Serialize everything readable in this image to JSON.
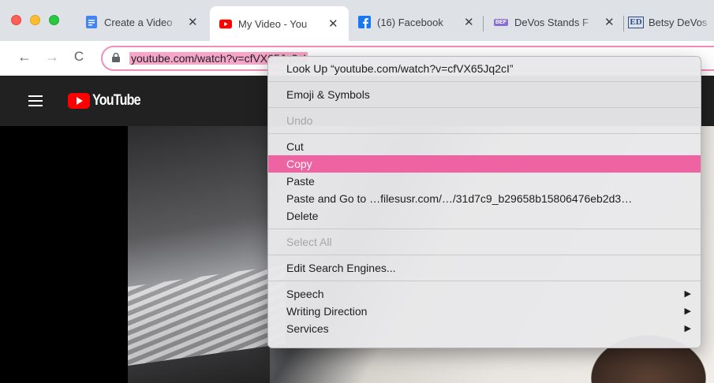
{
  "browser": {
    "tabs": [
      {
        "title": "Create a Video",
        "favicon": "google-docs-icon",
        "active": false
      },
      {
        "title": "My Video - You",
        "favicon": "youtube-icon",
        "active": true
      },
      {
        "title": "(16) Facebook",
        "favicon": "facebook-icon",
        "active": false
      },
      {
        "title": "DeVos Stands F",
        "favicon": "news-icon",
        "active": false
      },
      {
        "title": "Betsy DeVos",
        "favicon": "ed-icon",
        "active": false
      }
    ],
    "close_glyph": "✕",
    "back_glyph": "←",
    "forward_glyph": "→",
    "reload_glyph": "C",
    "url": "youtube.com/watch?v=cfVX65Jq2cI",
    "ed_favicon_text": "ED",
    "news_favicon_text": "BEF"
  },
  "youtube": {
    "logo_text": "YouTube"
  },
  "context_menu": {
    "items": [
      {
        "label": "Look Up “youtube.com/watch?v=cfVX65Jq2cI”",
        "disabled": false
      },
      {
        "label": "Emoji & Symbols",
        "disabled": false
      },
      {
        "label": "Undo",
        "disabled": true
      },
      {
        "label": "Cut",
        "disabled": false
      },
      {
        "label": "Copy",
        "disabled": false,
        "highlighted": true
      },
      {
        "label": "Paste",
        "disabled": false
      },
      {
        "label": "Paste and Go to …filesusr.com/…/31d7c9_b29658b15806476eb2d3…",
        "disabled": false
      },
      {
        "label": "Delete",
        "disabled": false
      },
      {
        "label": "Select All",
        "disabled": true
      },
      {
        "label": "Edit Search Engines...",
        "disabled": false
      },
      {
        "label": "Speech",
        "submenu": true
      },
      {
        "label": "Writing Direction",
        "submenu": true
      },
      {
        "label": "Services",
        "submenu": true
      }
    ],
    "submenu_arrow": "▶"
  },
  "colors": {
    "highlight": "#ee64a3",
    "omnibox_focus": "#f28fb8",
    "youtube_red": "#ff0000",
    "facebook_blue": "#1877f2",
    "docs_blue": "#4285f4"
  }
}
